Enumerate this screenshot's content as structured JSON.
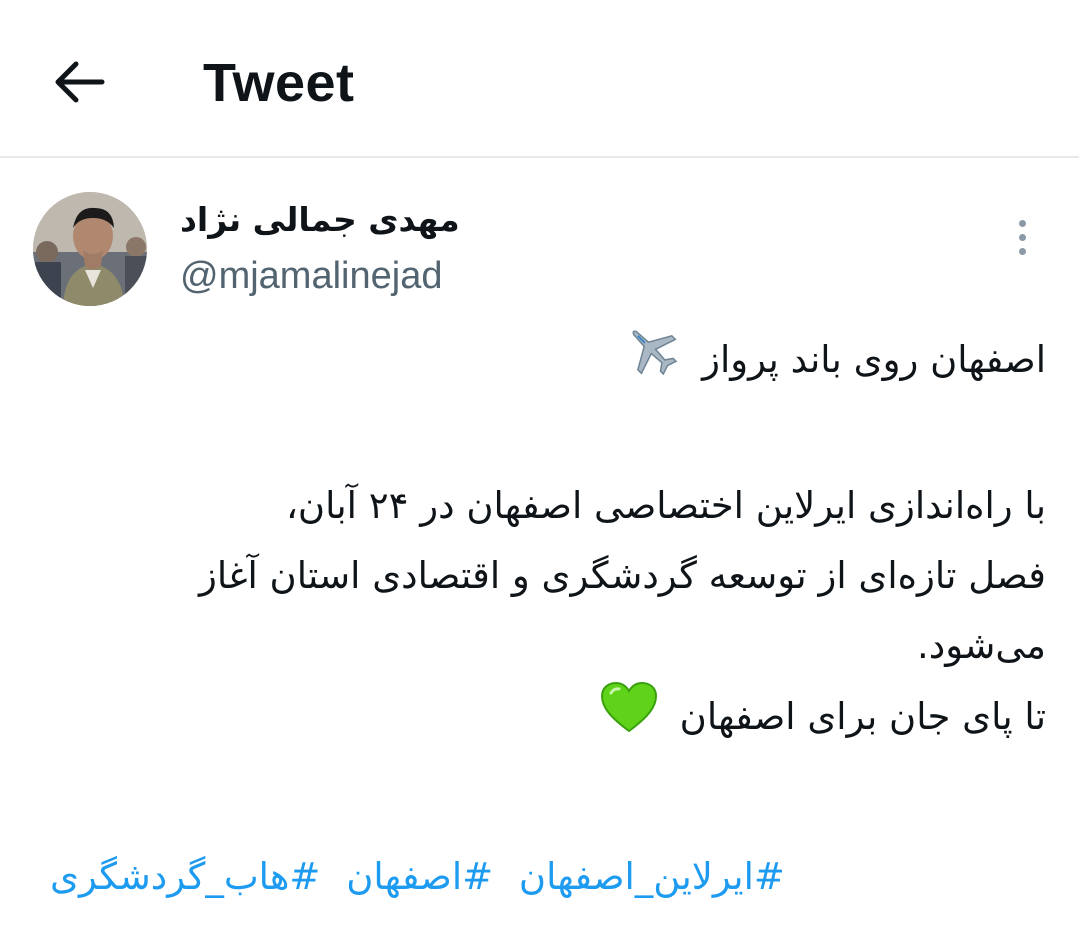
{
  "header": {
    "title": "Tweet",
    "back_icon": "arrow-left-icon"
  },
  "author": {
    "display_name": "مهدی جمالی نژاد",
    "handle": "@mjamalinejad",
    "more_icon": "more-vertical-icon"
  },
  "tweet": {
    "line1": "اصفهان روی باند پرواز",
    "line1_emoji": "airplane-icon",
    "line2": "با راه‌اندازی ایرلاین اختصاصی اصفهان در ۲۴ آبان،",
    "line3": "فصل تازه‌ای از توسعه گردشگری و اقتصادی استان آغاز",
    "line4": "می‌شود.",
    "line5": "تا پای جان برای اصفهان",
    "line5_emoji": "green-heart-icon",
    "hashtags": [
      "#ایرلاین_اصفهان",
      "#اصفهان",
      "#هاب_گردشگری"
    ]
  },
  "colors": {
    "text": "#0f1419",
    "secondary": "#536471",
    "link": "#1d9bf0",
    "divider": "#e6e8ea"
  }
}
